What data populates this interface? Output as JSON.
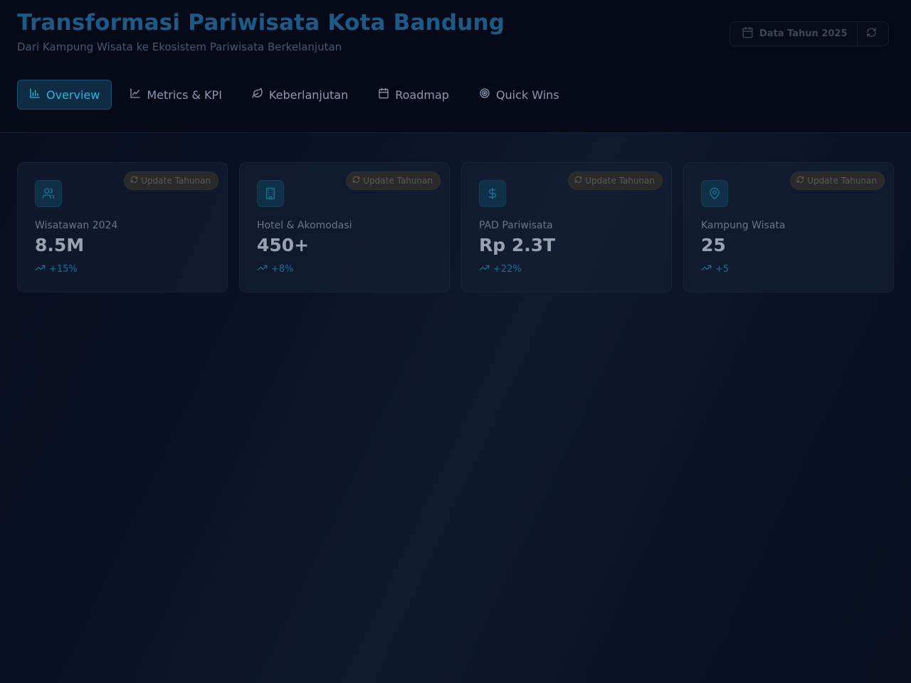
{
  "header": {
    "title": "Transformasi Pariwisata Kota Bandung",
    "subtitle": "Dari Kampung Wisata ke Ekosistem Pariwisata Berkelanjutan",
    "year_button": "Data Tahun 2025",
    "year_icon": "calendar-icon",
    "refresh_icon": "refresh-icon"
  },
  "tabs": [
    {
      "label": "Overview",
      "icon": "bar-chart-icon",
      "active": true
    },
    {
      "label": "Metrics & KPI",
      "icon": "line-chart-icon",
      "active": false
    },
    {
      "label": "Keberlanjutan",
      "icon": "leaf-icon",
      "active": false
    },
    {
      "label": "Roadmap",
      "icon": "calendar-icon",
      "active": false
    },
    {
      "label": "Quick Wins",
      "icon": "target-icon",
      "active": false
    }
  ],
  "cards": [
    {
      "label": "Wisatawan 2024",
      "value": "8.5M",
      "trend": "+15%",
      "badge": "Update Tahunan",
      "icon": "users-icon"
    },
    {
      "label": "Hotel & Akomodasi",
      "value": "450+",
      "trend": "+8%",
      "badge": "Update Tahunan",
      "icon": "building-icon"
    },
    {
      "label": "PAD Pariwisata",
      "value": "Rp 2.3T",
      "trend": "+22%",
      "badge": "Update Tahunan",
      "icon": "dollar-icon"
    },
    {
      "label": "Kampung Wisata",
      "value": "25",
      "trend": "+5",
      "badge": "Update Tahunan",
      "icon": "map-pin-icon"
    }
  ],
  "colors": {
    "accent": "#28b5dc",
    "title": "#1d5b86",
    "background": "#0b1226",
    "trend": "#1f6e8e"
  }
}
